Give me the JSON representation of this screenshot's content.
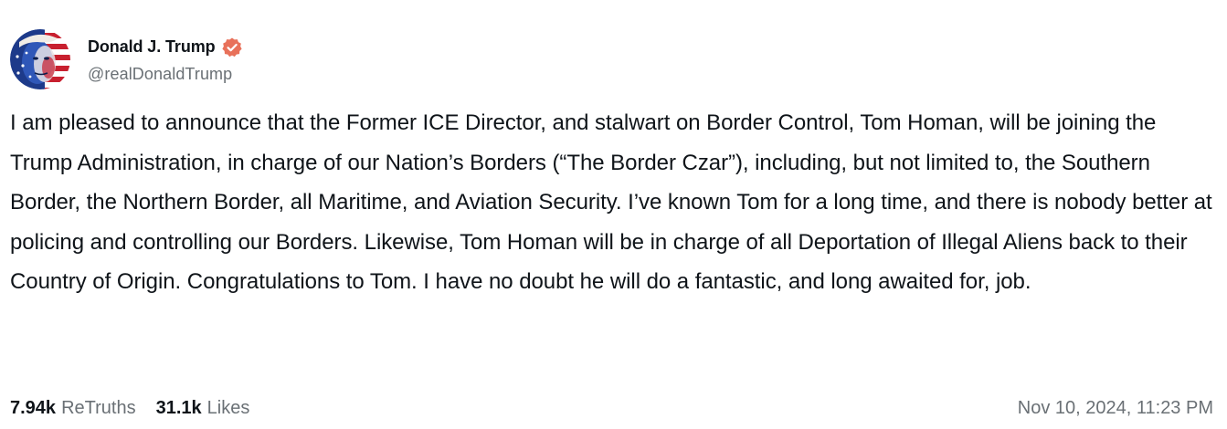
{
  "author": {
    "display_name": "Donald J. Trump",
    "handle": "@realDonaldTrump",
    "verified": true,
    "verified_badge_color": "#e8715a",
    "avatar_icon": "profile-photo"
  },
  "post": {
    "text": "I am pleased to announce that the Former ICE Director, and stalwart on Border Control, Tom Homan, will be joining the Trump Administration, in charge of our Nation’s Borders (“The Border Czar”), including, but not limited to, the Southern Border, the Northern Border, all Maritime, and Aviation Security. I’ve known Tom for a long time, and there is nobody better at policing and controlling our Borders. Likewise, Tom Homan will be in charge of all Deportation of Illegal Aliens back to their Country of Origin. Congratulations to Tom. I have no doubt he will do a fantastic, and long awaited for, job."
  },
  "stats": {
    "retruths_count": "7.94k",
    "retruths_label": "ReTruths",
    "likes_count": "31.1k",
    "likes_label": "Likes"
  },
  "timestamp": "Nov 10, 2024, 11:23 PM",
  "colors": {
    "text_primary": "#0f1419",
    "text_secondary": "#6a7075",
    "background": "#ffffff"
  }
}
